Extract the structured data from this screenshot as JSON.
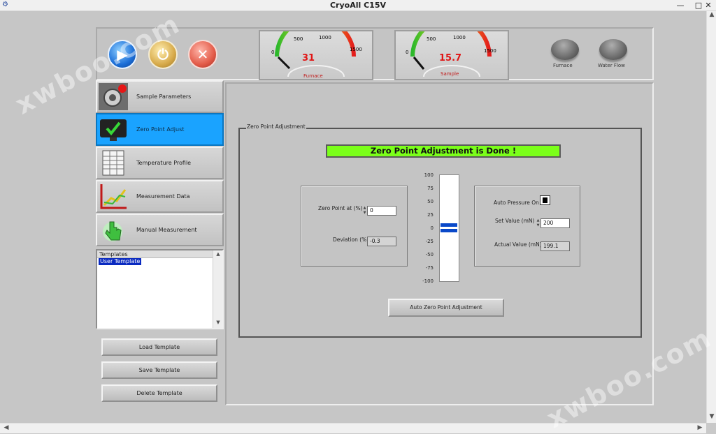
{
  "window": {
    "title": "CryoAll C15V",
    "minimize": "—",
    "maximize": "□",
    "close": "✕"
  },
  "toolbar": {
    "start_icon": "play-icon",
    "power_icon": "power-icon",
    "close_icon": "close-icon"
  },
  "gauges": {
    "furnace": {
      "label": "Furnace",
      "value": "31",
      "ticks": [
        "0",
        "500",
        "1000",
        "1500"
      ]
    },
    "sample": {
      "label": "Sample",
      "value": "15.7",
      "ticks": [
        "0",
        "500",
        "1000",
        "1500"
      ]
    }
  },
  "indicators": {
    "furnace": "Furnace",
    "water_flow": "Water Flow"
  },
  "nav": {
    "items": [
      {
        "label": "Sample Parameters",
        "icon": "gear-icon"
      },
      {
        "label": "Zero Point Adjust",
        "icon": "monitor-check-icon"
      },
      {
        "label": "Temperature Profile",
        "icon": "spreadsheet-icon"
      },
      {
        "label": "Measurement Data",
        "icon": "chart-icon"
      },
      {
        "label": "Manual Measurement",
        "icon": "hand-icon"
      }
    ]
  },
  "templates": {
    "header": "Templates",
    "items": [
      "User Template"
    ]
  },
  "buttons": {
    "load": "Load Template",
    "save": "Save Template",
    "delete": "Delete Template",
    "auto_zero": "Auto Zero Point Adjustment"
  },
  "zero_point": {
    "group_label": "Zero Point Adjustment",
    "status": "Zero Point Adjustment is Done !",
    "zero_point_label": "Zero Point at (%)",
    "zero_point_value": "0",
    "deviation_label": "Deviation (%)",
    "deviation_value": "-0.3",
    "scale": [
      "100",
      "75",
      "50",
      "25",
      "0",
      "-25",
      "-50",
      "-75",
      "-100"
    ],
    "auto_pressure_label": "Auto Pressure On",
    "set_value_label": "Set Value (mN)",
    "set_value": "200",
    "actual_value_label": "Actual Value (mN)",
    "actual_value": "199.1"
  },
  "watermark": "xwboo.com",
  "colors": {
    "active_nav": "#1aa3ff",
    "status_banner": "#7bff1a",
    "gauge_value": "#e01515",
    "indicator_bar": "#0a49c9"
  }
}
